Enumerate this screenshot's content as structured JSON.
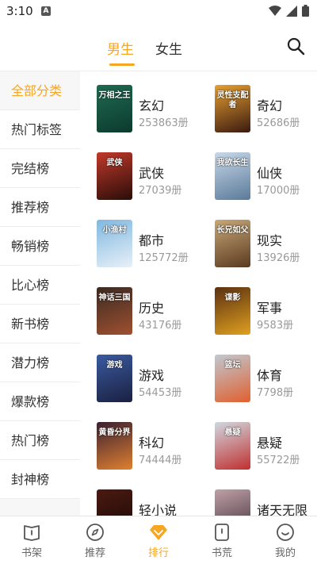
{
  "status": {
    "time": "3:10",
    "notif": "A"
  },
  "tabs": {
    "male": "男生",
    "female": "女生"
  },
  "colors": {
    "accent": "#f5a623"
  },
  "sidebar": {
    "items": [
      {
        "label": "全部分类",
        "active": true
      },
      {
        "label": "热门标签"
      },
      {
        "label": "完结榜"
      },
      {
        "label": "推荐榜"
      },
      {
        "label": "畅销榜"
      },
      {
        "label": "比心榜"
      },
      {
        "label": "新书榜"
      },
      {
        "label": "潜力榜"
      },
      {
        "label": "爆款榜"
      },
      {
        "label": "热门榜"
      },
      {
        "label": "封神榜"
      }
    ]
  },
  "categories": [
    {
      "name": "玄幻",
      "count": "253863册",
      "cover_text": "万相之王",
      "color1": "#1f6a52",
      "color2": "#0c3a2c"
    },
    {
      "name": "奇幻",
      "count": "52686册",
      "cover_text": "灵性支配者",
      "color1": "#e8a030",
      "color2": "#3a1a10"
    },
    {
      "name": "武侠",
      "count": "27039册",
      "cover_text": "武侠",
      "color1": "#c0392b",
      "color2": "#2a0d08"
    },
    {
      "name": "仙侠",
      "count": "17000册",
      "cover_text": "我欲长生",
      "color1": "#c8d8e8",
      "color2": "#5a7a9a"
    },
    {
      "name": "都市",
      "count": "125772册",
      "cover_text": "小渔村",
      "color1": "#7fb8e0",
      "color2": "#e8f0f8"
    },
    {
      "name": "现实",
      "count": "13926册",
      "cover_text": "长兄如父",
      "color1": "#c8a878",
      "color2": "#5a3a20"
    },
    {
      "name": "历史",
      "count": "43176册",
      "cover_text": "神话三国",
      "color1": "#3a2a22",
      "color2": "#a05030"
    },
    {
      "name": "军事",
      "count": "9583册",
      "cover_text": "谍影",
      "color1": "#5a3010",
      "color2": "#e0a020"
    },
    {
      "name": "游戏",
      "count": "54453册",
      "cover_text": "游戏",
      "color1": "#3a5aa0",
      "color2": "#1a2040"
    },
    {
      "name": "体育",
      "count": "7798册",
      "cover_text": "篮坛",
      "color1": "#c0c8d0",
      "color2": "#e06030"
    },
    {
      "name": "科幻",
      "count": "74444册",
      "cover_text": "黄昏分界",
      "color1": "#3a2030",
      "color2": "#e08030"
    },
    {
      "name": "悬疑",
      "count": "55722册",
      "cover_text": "悬疑",
      "color1": "#d0d8e0",
      "color2": "#c03030"
    },
    {
      "name": "轻小说",
      "count": "",
      "cover_text": "",
      "color1": "#4a1a10",
      "color2": "#1a0808"
    },
    {
      "name": "诸天无限",
      "count": "",
      "cover_text": "",
      "color1": "#c0a0a8",
      "color2": "#403038"
    }
  ],
  "nav": {
    "shelf": "书架",
    "recommend": "推荐",
    "rank": "排行",
    "wasteland": "书荒",
    "mine": "我的"
  }
}
